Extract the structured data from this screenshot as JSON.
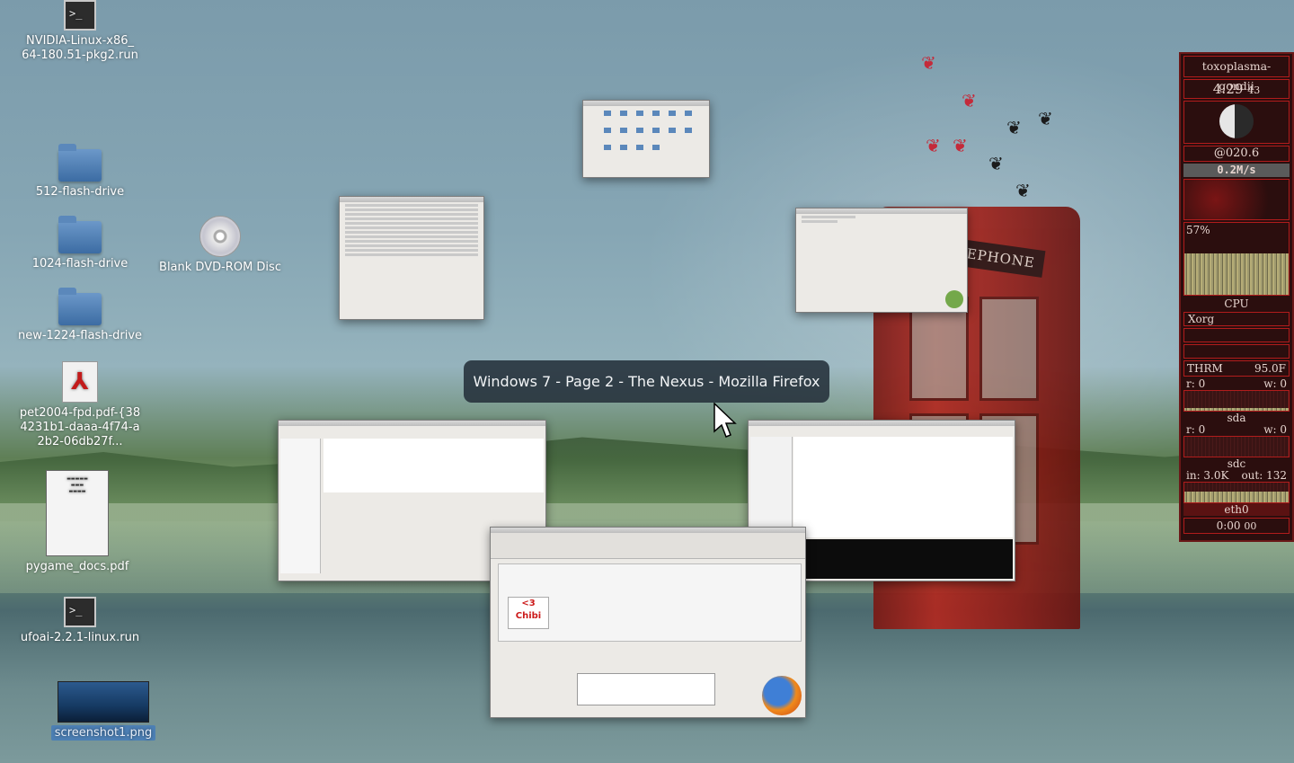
{
  "desktop_icons": [
    {
      "label": "NVIDIA-Linux-x86_\n64-180.51-pkg2.run",
      "icon": "terminal-icon"
    },
    {
      "label": "512-flash-drive",
      "icon": "folder-icon"
    },
    {
      "label": "1024-flash-drive",
      "icon": "folder-icon"
    },
    {
      "label": "Blank DVD-ROM Disc",
      "icon": "disc-icon"
    },
    {
      "label": "new-1224-flash-drive",
      "icon": "folder-icon"
    },
    {
      "label": "pet2004-fpd.pdf-{384231b1-daaa-4f74-a2b2-06db27f...",
      "icon": "pdf-icon"
    },
    {
      "label": "pygame_docs.pdf",
      "icon": "document-thumbnail"
    },
    {
      "label": "ufoai-2.2.1-linux.run",
      "icon": "terminal-icon"
    },
    {
      "label": "screenshot1.png",
      "icon": "image-thumbnail"
    }
  ],
  "wallpaper": {
    "booth_sign": "TELEPHONE"
  },
  "window_switcher": {
    "tooltip": "Windows 7 - Page 2 - The Nexus - Mozilla Firefox",
    "firefox_badge": "<3 Chibi"
  },
  "conky": {
    "hostname": "toxoplasma-gondii",
    "time": "4:29",
    "seconds": "43",
    "beat": "@020.6",
    "net_rate": "0.2M/s",
    "cpu_percent": "57%",
    "cpu_label": "CPU",
    "top_process": "Xorg",
    "thermal_label": "THRM",
    "thermal_value": "95.0F",
    "sda_read": "r: 0",
    "sda_write": "w: 0",
    "sda_label": "sda",
    "sdc_read": "r: 0",
    "sdc_write": "w: 0",
    "sdc_label": "sdc",
    "eth_in": "in: 3.0K",
    "eth_out": "out: 132",
    "eth_label": "eth0",
    "uptime": "0:00",
    "uptime_seconds": "00"
  },
  "colors": {
    "tooltip_bg": "#24303a",
    "conky_border": "#b11c1c",
    "conky_bg": "#2b0e0e",
    "booth_red": "#b3261d"
  }
}
